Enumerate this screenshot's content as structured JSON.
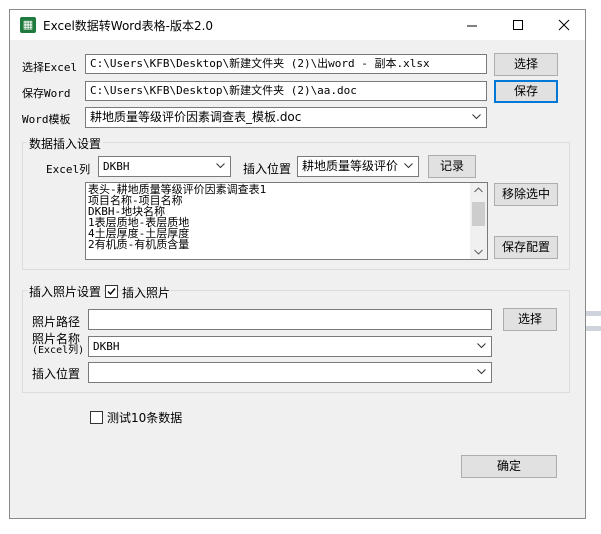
{
  "window": {
    "title": "Excel数据转Word表格-版本2.0"
  },
  "files": {
    "excel_label": "选择Excel",
    "excel_path": "C:\\Users\\KFB\\Desktop\\新建文件夹 (2)\\出word - 副本.xlsx",
    "excel_button": "选择",
    "word_label": "保存Word",
    "word_path": "C:\\Users\\KFB\\Desktop\\新建文件夹 (2)\\aa.doc",
    "word_button": "保存",
    "template_label": "Word模板",
    "template_value": "耕地质量等级评价因素调查表_模板.doc"
  },
  "insert": {
    "group_title": "数据插入设置",
    "column_label": "Excel列",
    "column_value": "DKBH",
    "position_label": "插入位置",
    "position_value": "耕地质量等级评价",
    "record_button": "记录",
    "items": [
      "表头-耕地质量等级评价因素调查表1",
      "项目名称-项目名称",
      "DKBH-地块名称",
      "1表层质地-表层质地",
      "4土层厚度-土层厚度",
      "2有机质-有机质含量"
    ],
    "remove_button": "移除选中",
    "save_config_button": "保存配置"
  },
  "photo": {
    "group_title": "插入照片设置",
    "checkbox_label": "插入照片",
    "path_label": "照片路径",
    "path_value": "",
    "path_button": "选择",
    "name_label_line1": "照片名称",
    "name_label_line2": "(Excel列)",
    "name_value": "DKBH",
    "position_label": "插入位置",
    "position_value": ""
  },
  "test": {
    "checkbox_label": "测试10条数据"
  },
  "ok_button": "确定"
}
